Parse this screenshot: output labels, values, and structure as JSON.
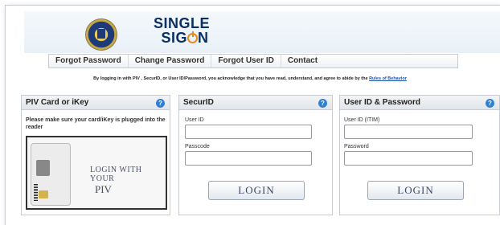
{
  "header": {
    "logo_line1": "SINGLE",
    "logo_line2_prefix": "SIG",
    "logo_line2_suffix": "N"
  },
  "nav": {
    "items": [
      "Forgot Password",
      "Change Password",
      "Forgot User ID",
      "Contact"
    ]
  },
  "notice": {
    "text": "By logging in with PIV , SecurID, or User ID/Password, you acknowledge that you have read, understand, and agree to abide by the ",
    "link": "Rules of Behavior"
  },
  "panels": {
    "piv": {
      "title": "PIV Card or iKey",
      "message": "Please make sure your card/iKey is plugged into the reader",
      "card_line1": "LOGIN WITH YOUR",
      "card_line2": "PIV"
    },
    "securid": {
      "title": "SecurID",
      "user_label": "User ID",
      "user_value": "",
      "pass_label": "Passcode",
      "pass_value": "",
      "button": "LOGIN"
    },
    "userpass": {
      "title": "User ID & Password",
      "user_label": "User ID (ITIM)",
      "user_value": "",
      "pass_label": "Password",
      "pass_value": "",
      "button": "LOGIN"
    },
    "help_glyph": "?"
  },
  "colors": {
    "brand_navy": "#0b2f63",
    "power_orange": "#e98a1a",
    "help_blue": "#2f7fd3",
    "link_blue": "#1a53b3"
  },
  "icons": [
    "seal-icon",
    "power-icon",
    "help-icon"
  ]
}
